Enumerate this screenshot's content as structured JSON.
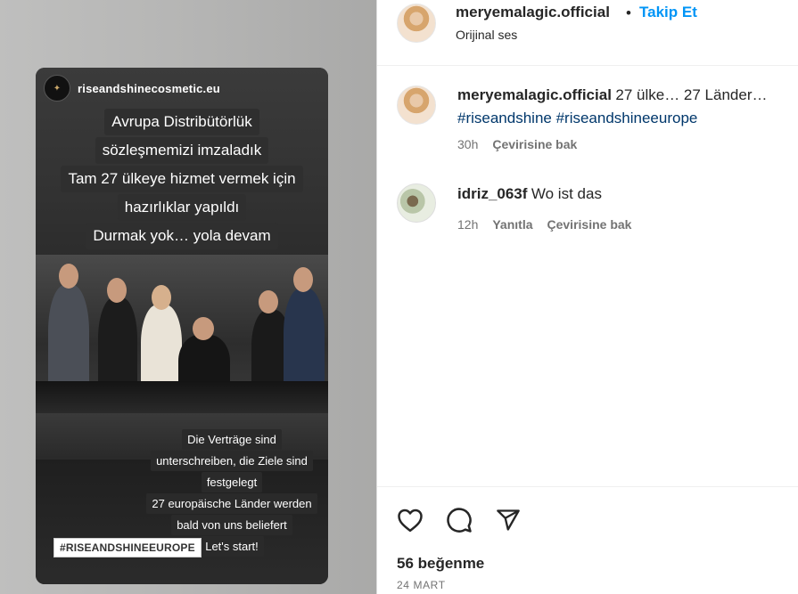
{
  "post_media": {
    "story_account": "riseandshinecosmetic.eu",
    "caption_lines": [
      "Avrupa Distribütörlük",
      "sözleşmemizi imzaladık",
      "Tam 27 ülkeye hizmet vermek için",
      "hazırlıklar yapıldı",
      "Durmak yok… yola devam"
    ],
    "caption_bottom_lines": [
      "Die Verträge sind",
      "unterschreiben, die Ziele sind",
      "festgelegt",
      "27 europäische Länder werden",
      "bald von uns beliefert",
      "Let's start!"
    ],
    "hashtag_sticker": "#RISEANDSHINEEUROPE"
  },
  "header": {
    "username": "meryemalagic.official",
    "separator": "•",
    "follow_label": "Takip Et",
    "audio_label": "Orijinal ses"
  },
  "comments": [
    {
      "username": "meryemalagic.official",
      "text": "27 ülke… 27 Länder…",
      "tags": "#riseandshine #riseandshineeurope",
      "time": "30h",
      "translate_label": "Çevirisine bak"
    },
    {
      "username": "idriz_063f",
      "text": "Wo ist das",
      "time": "12h",
      "reply_label": "Yanıtla",
      "translate_label": "Çevirisine bak"
    }
  ],
  "actions": {
    "like_icon": "heart-icon",
    "comment_icon": "comment-bubble-icon",
    "share_icon": "paper-plane-icon"
  },
  "likes_text": "56 beğenme",
  "date_text": "24 MART"
}
